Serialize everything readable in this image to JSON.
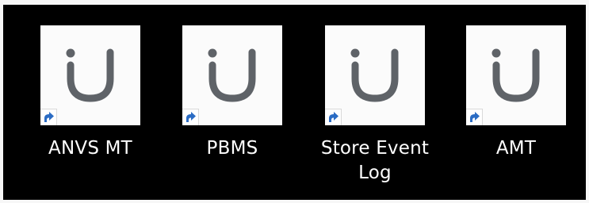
{
  "desktop": {
    "shortcuts": [
      {
        "label": "ANVS MT",
        "icon": "app-u-logo-icon",
        "badge": "shortcut-arrow-icon"
      },
      {
        "label": "PBMS",
        "icon": "app-u-logo-icon",
        "badge": "shortcut-arrow-icon"
      },
      {
        "label": "Store Event Log",
        "icon": "app-u-logo-icon",
        "badge": "shortcut-arrow-icon"
      },
      {
        "label": "AMT",
        "icon": "app-u-logo-icon",
        "badge": "shortcut-arrow-icon"
      }
    ]
  },
  "colors": {
    "background": "#000000",
    "tile": "#fbfbfb",
    "logo": "#5f6368",
    "arrow": "#2b6cc4",
    "label": "#ffffff"
  }
}
